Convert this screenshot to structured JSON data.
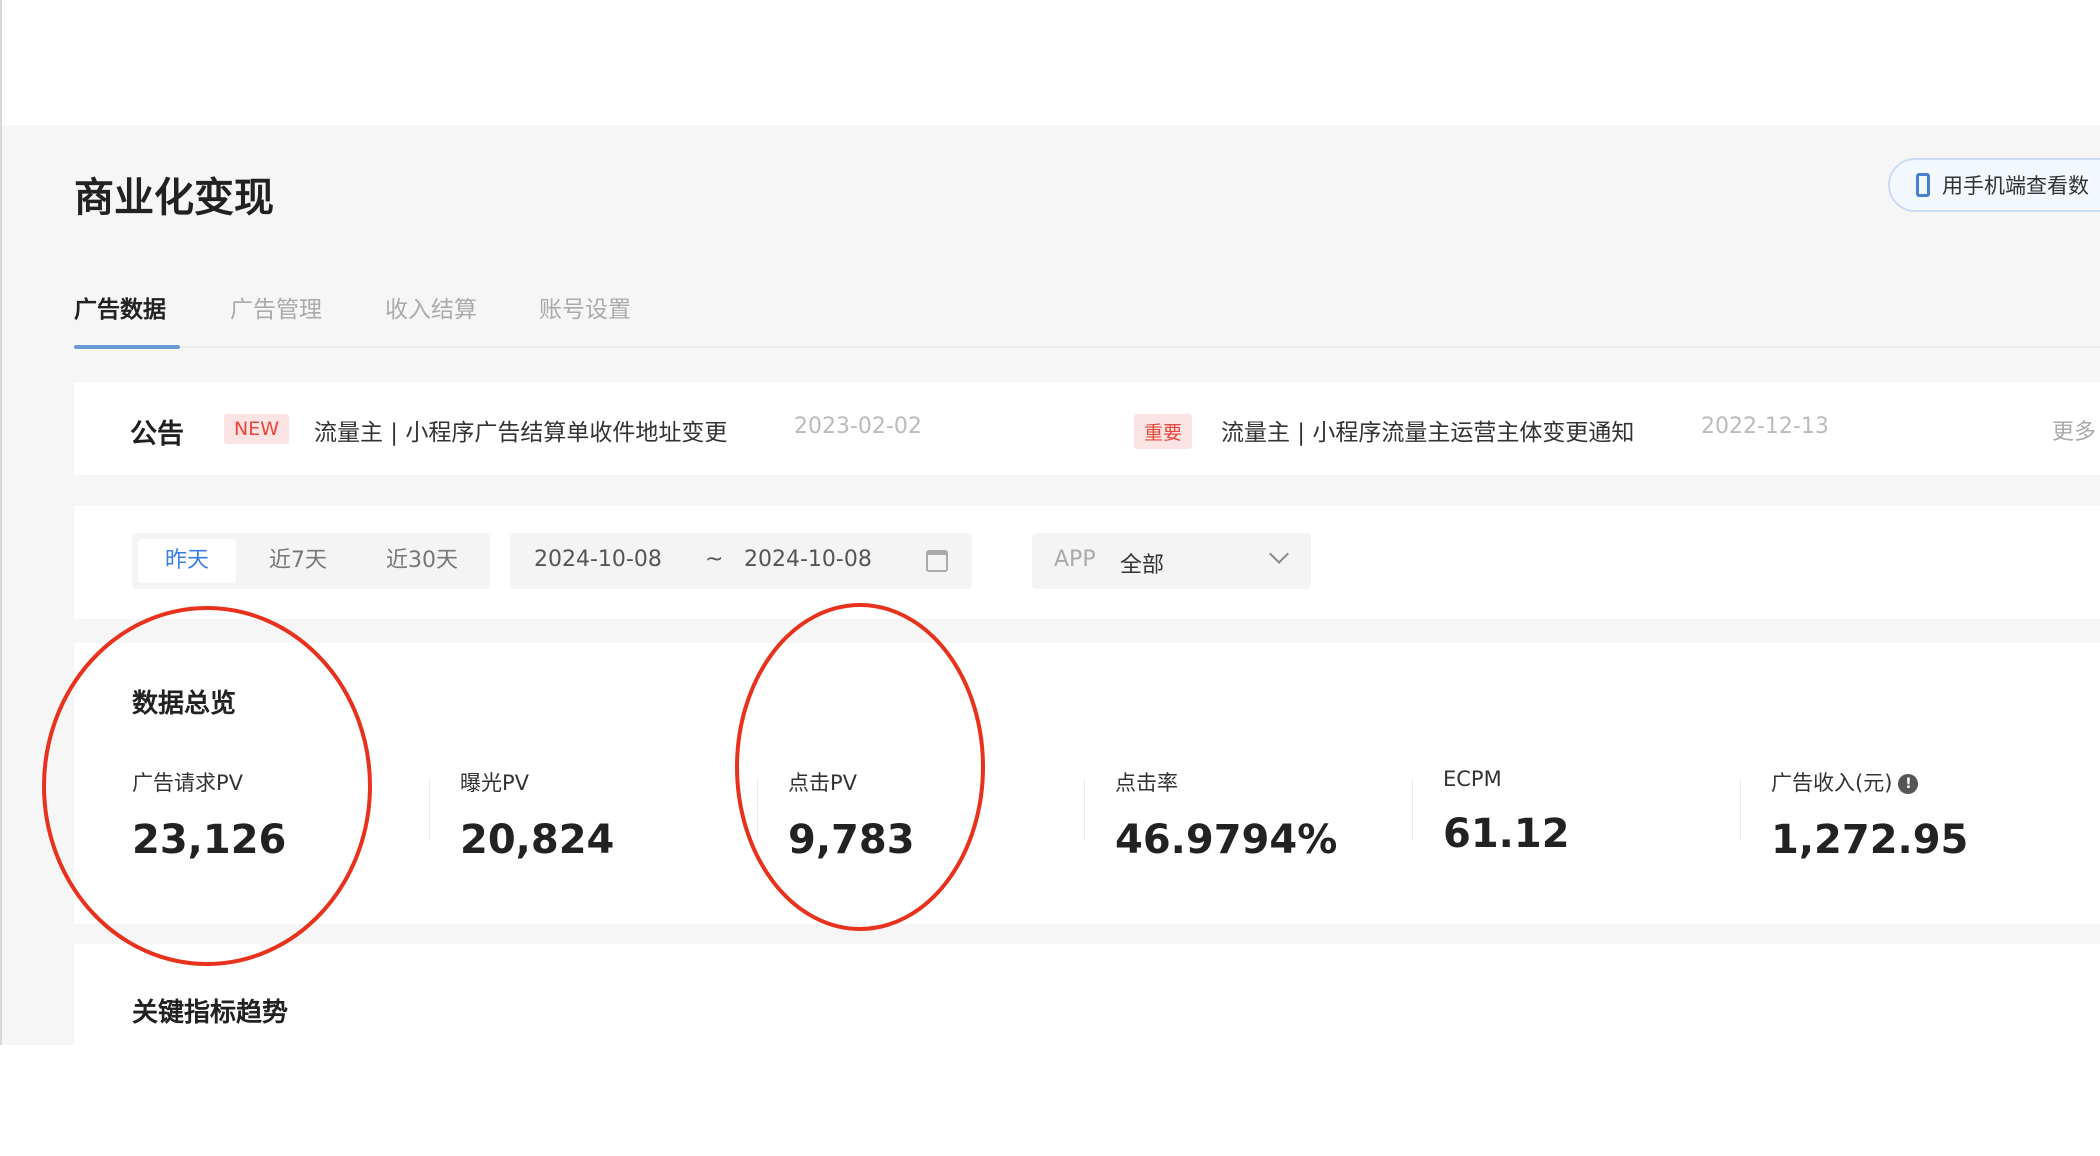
{
  "page_title": "商业化变现",
  "mobile_button": {
    "label": "用手机端查看数",
    "icon": "phone-icon"
  },
  "tabs": [
    {
      "label": "广告数据",
      "active": true
    },
    {
      "label": "广告管理"
    },
    {
      "label": "收入结算"
    },
    {
      "label": "账号设置"
    }
  ],
  "announcements": {
    "title": "公告",
    "items": [
      {
        "tag": "NEW",
        "text": "流量主 | 小程序广告结算单收件地址变更",
        "date": "2023-02-02"
      },
      {
        "tag": "重要",
        "text": "流量主 | 小程序流量主运营主体变更通知",
        "date": "2022-12-13"
      }
    ],
    "more": "更多"
  },
  "filters": {
    "ranges": [
      "昨天",
      "近7天",
      "近30天"
    ],
    "selected_range": "昨天",
    "start_date": "2024-10-08",
    "separator": "~",
    "end_date": "2024-10-08",
    "app_label": "APP",
    "app_value": "全部"
  },
  "overview": {
    "title": "数据总览",
    "stats": [
      {
        "label": "广告请求PV",
        "value": "23,126"
      },
      {
        "label": "曝光PV",
        "value": "20,824"
      },
      {
        "label": "点击PV",
        "value": "9,783"
      },
      {
        "label": "点击率",
        "value": "46.9794%"
      },
      {
        "label": "ECPM",
        "value": "61.12"
      },
      {
        "label": "广告收入(元)",
        "value": "1,272.95"
      }
    ]
  },
  "trend": {
    "title": "关键指标趋势"
  },
  "annotation_color": "#e8321e",
  "accent_color": "#3a7ee6"
}
